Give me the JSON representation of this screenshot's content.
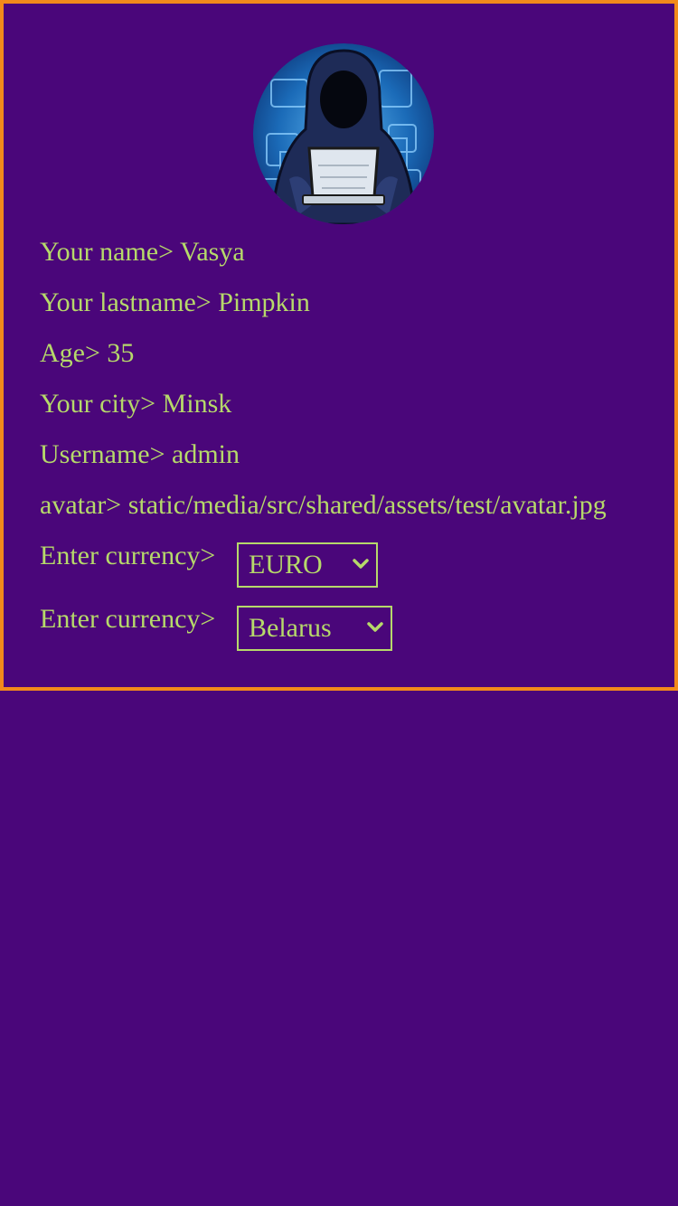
{
  "profile": {
    "name_label": "Your name>",
    "name": "Vasya",
    "lastname_label": "Your lastname>",
    "lastname": "Pimpkin",
    "age_label": "Age>",
    "age": "35",
    "city_label": "Your city>",
    "city": "Minsk",
    "username_label": "Username>",
    "username": "admin",
    "avatar_label": "avatar>",
    "avatar": "static/media/src/shared/assets/test/avatar.jpg"
  },
  "currency": {
    "label": "Enter currency>",
    "selected": "EURO"
  },
  "country": {
    "label": "Enter currency>",
    "selected": "Belarus"
  },
  "colors": {
    "background": "#4a067a",
    "border": "#f28a1b",
    "text": "#b6d96a"
  },
  "icons": {
    "avatar": "hooded-hacker-avatar",
    "select_arrow": "chevron-down-icon"
  }
}
